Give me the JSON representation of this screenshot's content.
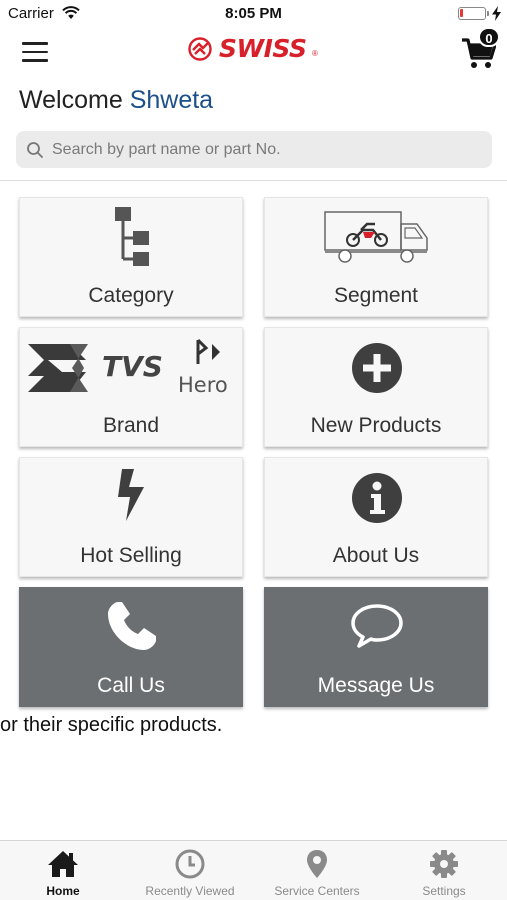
{
  "status_bar": {
    "carrier": "Carrier",
    "time": "8:05 PM",
    "battery_level": 0.12,
    "battery_color": "#e53935"
  },
  "header": {
    "menu_icon": "hamburger-icon",
    "logo_text": "SWISS",
    "logo_registered": "®",
    "brand_color": "#d8202a",
    "cart_icon": "cart-icon",
    "cart_count": "0"
  },
  "welcome": {
    "greeting": "Welcome",
    "name": "Shweta",
    "name_color": "#1d4f8a"
  },
  "search": {
    "placeholder": "Search by part name or part No.",
    "value": "",
    "icon": "search-icon"
  },
  "tiles": [
    {
      "label": "Category",
      "icon": "category-tree-icon"
    },
    {
      "label": "Segment",
      "icon": "truck-motorcycle-icon"
    },
    {
      "label": "Brand",
      "icon": "brand-logos-icon",
      "logos": [
        "TVS",
        "Hero"
      ]
    },
    {
      "label": "New Products",
      "icon": "plus-circle-icon"
    },
    {
      "label": "Hot Selling",
      "icon": "lightning-icon"
    },
    {
      "label": "About Us",
      "icon": "info-circle-icon"
    },
    {
      "label": "Call Us",
      "icon": "phone-icon"
    },
    {
      "label": "Message Us",
      "icon": "chat-bubble-icon"
    }
  ],
  "tile_colors": {
    "light": "#f7f7f7",
    "dark": "#6c6f72"
  },
  "marquee_text": "or their specific products.",
  "tabbar": {
    "tabs": [
      {
        "label": "Home",
        "icon": "home-icon",
        "active": true
      },
      {
        "label": "Recently Viewed",
        "icon": "clock-icon",
        "active": false
      },
      {
        "label": "Service Centers",
        "icon": "location-pin-icon",
        "active": false
      },
      {
        "label": "Settings",
        "icon": "gear-icon",
        "active": false
      }
    ]
  }
}
